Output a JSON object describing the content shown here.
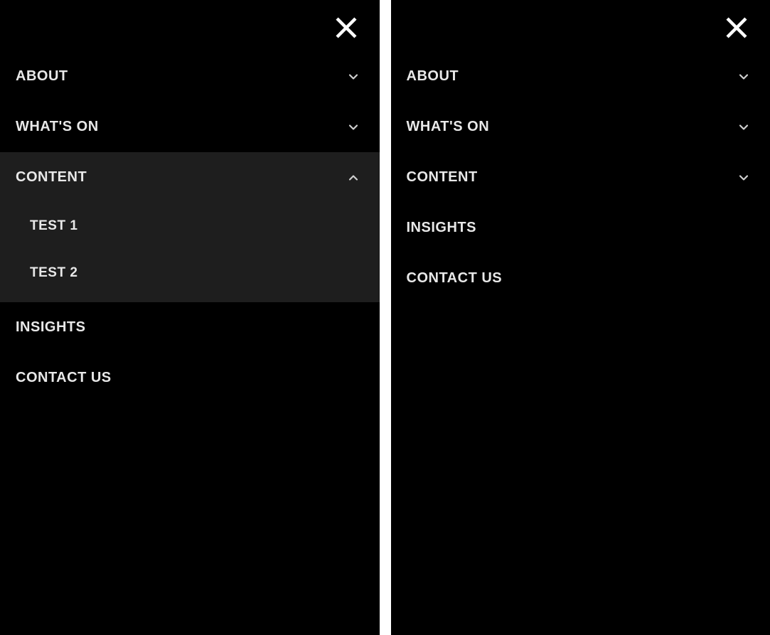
{
  "left_panel": {
    "items": [
      {
        "label": "ABOUT",
        "expandable": true,
        "expanded": false
      },
      {
        "label": "WHAT'S ON",
        "expandable": true,
        "expanded": false
      },
      {
        "label": "CONTENT",
        "expandable": true,
        "expanded": true,
        "children": [
          {
            "label": "TEST 1"
          },
          {
            "label": "TEST 2"
          }
        ]
      },
      {
        "label": "INSIGHTS",
        "expandable": false
      },
      {
        "label": "CONTACT US",
        "expandable": false
      }
    ]
  },
  "right_panel": {
    "items": [
      {
        "label": "ABOUT",
        "expandable": true,
        "expanded": false
      },
      {
        "label": "WHAT'S ON",
        "expandable": true,
        "expanded": false
      },
      {
        "label": "CONTENT",
        "expandable": true,
        "expanded": false
      },
      {
        "label": "INSIGHTS",
        "expandable": false
      },
      {
        "label": "CONTACT US",
        "expandable": false
      }
    ]
  }
}
